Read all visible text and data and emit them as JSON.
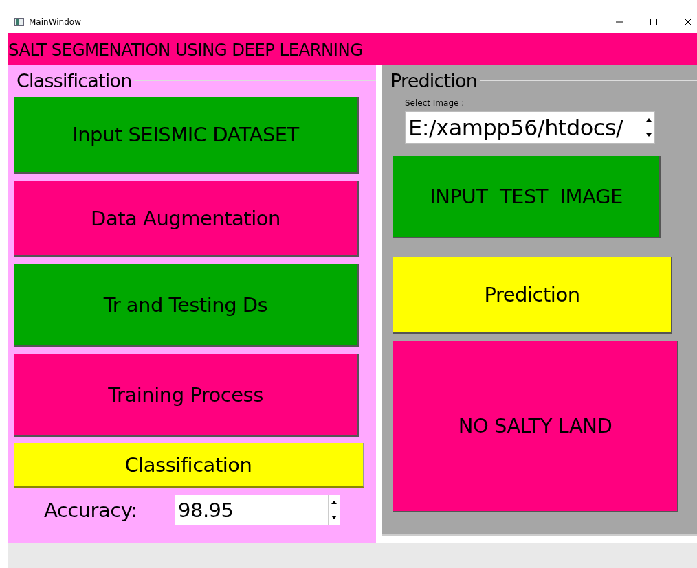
{
  "window": {
    "title": "MainWindow"
  },
  "header": {
    "title": "SALT SEGMENATION USING DEEP LEARNING"
  },
  "classification": {
    "title": "Classification",
    "buttons": [
      {
        "label": "Input SEISMIC DATASET",
        "color": "#00a800"
      },
      {
        "label": "Data Augmentation",
        "color": "#ff007f"
      },
      {
        "label": "Tr and Testing Ds",
        "color": "#00a800"
      },
      {
        "label": "Training Process",
        "color": "#ff007f"
      },
      {
        "label": "Classification",
        "color": "#ffff00"
      }
    ],
    "accuracy": {
      "label": "Accuracy:",
      "value": "98.95"
    }
  },
  "prediction": {
    "title": "Prediction",
    "select_label": "Select  Image :",
    "select_value": "E:/xampp56/htdocs/",
    "buttons": [
      {
        "label": "INPUT  TEST  IMAGE",
        "color": "#00a800"
      },
      {
        "label": "Prediction",
        "color": "#ffff00"
      },
      {
        "label": "NO SALTY LAND",
        "color": "#ff007f"
      }
    ]
  }
}
